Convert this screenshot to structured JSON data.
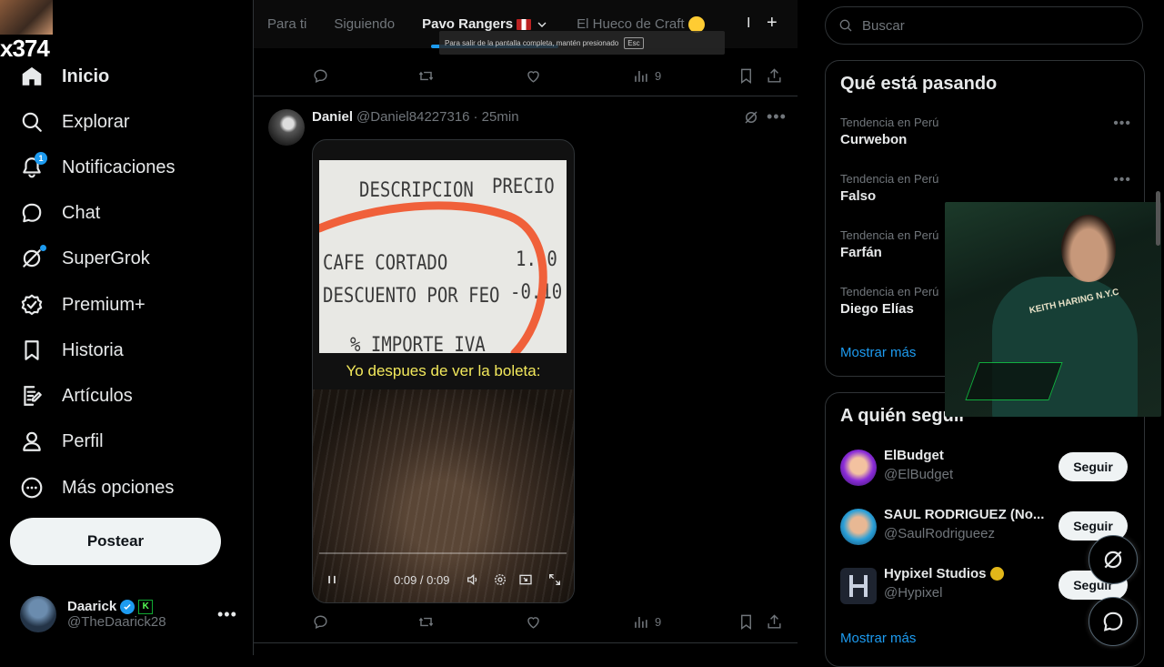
{
  "overlay": {
    "streamer_tag": "x374"
  },
  "sidebar": {
    "items": [
      {
        "label": "Inicio",
        "icon": "home-icon"
      },
      {
        "label": "Explorar",
        "icon": "search-icon"
      },
      {
        "label": "Notificaciones",
        "icon": "bell-icon",
        "badge": "1"
      },
      {
        "label": "Chat",
        "icon": "chat-bubble-icon"
      },
      {
        "label": "SuperGrok",
        "icon": "grok-icon"
      },
      {
        "label": "Premium+",
        "icon": "premium-badge-icon"
      },
      {
        "label": "Historia",
        "icon": "bookmark-icon"
      },
      {
        "label": "Artículos",
        "icon": "article-icon"
      },
      {
        "label": "Perfil",
        "icon": "person-icon"
      },
      {
        "label": "Más opciones",
        "icon": "more-circle-icon"
      }
    ],
    "post_label": "Postear",
    "account": {
      "name": "Daarick",
      "handle": "@TheDaarick28",
      "badge_letter": "K"
    }
  },
  "tabs": {
    "items": [
      "Para ti",
      "Siguiendo",
      "Pavo Rangers",
      "El Hueco de Craft"
    ],
    "active": "Pavo Rangers",
    "separator": "I",
    "add": "+"
  },
  "fullscreen_notice": {
    "text": "Para salir de la pantalla completa, mantén presionado",
    "key": "Esc"
  },
  "prev_tweet": {
    "views": "9"
  },
  "tweet": {
    "name": "Daniel",
    "handle": "@Daniel84227316",
    "time": "· 25min",
    "receipt": {
      "col_desc": "DESCRIPCION",
      "col_price": "PRECIO",
      "line1": "CAFE CORTADO",
      "line1_price": "1.10",
      "line2": "DESCUENTO POR FEO",
      "line2_price": "-0.10",
      "line3": "%  IMPORTE IVA"
    },
    "caption": "Yo despues de ver la boleta:",
    "video_time": "0:09 / 0:09",
    "views": "9"
  },
  "right": {
    "search_placeholder": "Buscar",
    "trends_title": "Qué está pasando",
    "trends": [
      {
        "context": "Tendencia en Perú",
        "name": "Curwebon"
      },
      {
        "context": "Tendencia en Perú",
        "name": "Falso"
      },
      {
        "context": "Tendencia en Perú",
        "name": "Farfán"
      },
      {
        "context": "Tendencia en Perú",
        "name": "Diego Elías"
      }
    ],
    "show_more": "Mostrar más",
    "follow_title": "A quién seguir",
    "follow": [
      {
        "name": "ElBudget",
        "handle": "@ElBudget",
        "button": "Seguir"
      },
      {
        "name": "SAUL RODRIGUEZ (No...",
        "handle": "@SaulRodrigueez",
        "button": "Seguir"
      },
      {
        "name": "Hypixel Studios",
        "handle": "@Hypixel",
        "button": "Seguir"
      }
    ],
    "follow_show_more": "Mostrar más"
  },
  "webcam": {
    "shirt_text": "KEITH HARING N.Y.C"
  },
  "colors": {
    "accent": "#1d9bf0",
    "background": "#000000",
    "border": "#2f3336",
    "muted": "#71767b"
  }
}
